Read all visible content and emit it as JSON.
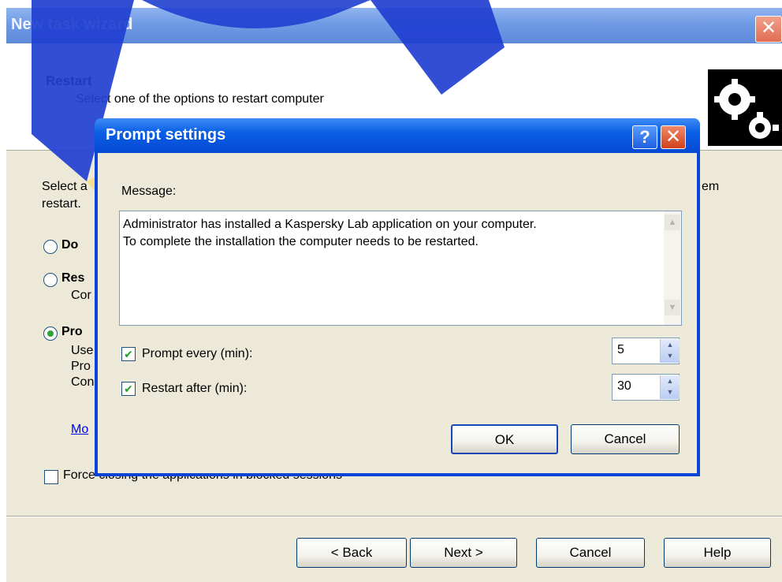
{
  "wizard": {
    "title": "New task wizard",
    "close_glyph": "✕",
    "header_title": "Restart",
    "header_subtitle": "Select one of the options to restart computer",
    "logo_icon": "gears-icon",
    "body_intro_line1": "Select a",
    "body_intro_line1_right": "em",
    "body_intro_line2": "restart.",
    "option1_label": "Do",
    "option2_label": "Res",
    "option2_desc": "Cor",
    "option3_label": "Pro",
    "option3_desc_line1": "Use",
    "option3_desc_line2": "Pro",
    "option3_desc_line3": "Con",
    "modify_link": "Mo",
    "force_close_label": "Force closing the applications in blocked sessions",
    "back_button": "< Back",
    "next_button": "Next >",
    "cancel_button": "Cancel",
    "help_button": "Help"
  },
  "dialog": {
    "title": "Prompt settings",
    "help_glyph": "?",
    "close_glyph": "✕",
    "message_label": "Message:",
    "message_text": "Administrator has installed a Kaspersky Lab application on your computer.\nTo complete the installation the computer needs to be restarted.",
    "prompt_every_label": "Prompt every (min):",
    "prompt_every_checked": true,
    "prompt_every_value": "5",
    "restart_after_label": "Restart after (min):",
    "restart_after_checked": true,
    "restart_after_value": "30",
    "ok_button": "OK",
    "cancel_button": "Cancel",
    "check_glyph": "✔",
    "scroll_up_glyph": "▲",
    "scroll_down_glyph": "▼",
    "spin_up_glyph": "▲",
    "spin_down_glyph": "▼"
  },
  "colors": {
    "wizard_titlebar": "#6f9ae5",
    "dialog_titlebar": "#0a5fe4",
    "dialog_frame": "#0b44d6",
    "face": "#ece9d8",
    "link": "#0000ee",
    "watermark_blue": "#1f3fd0",
    "watermark_yellow": "#ffd54a"
  }
}
